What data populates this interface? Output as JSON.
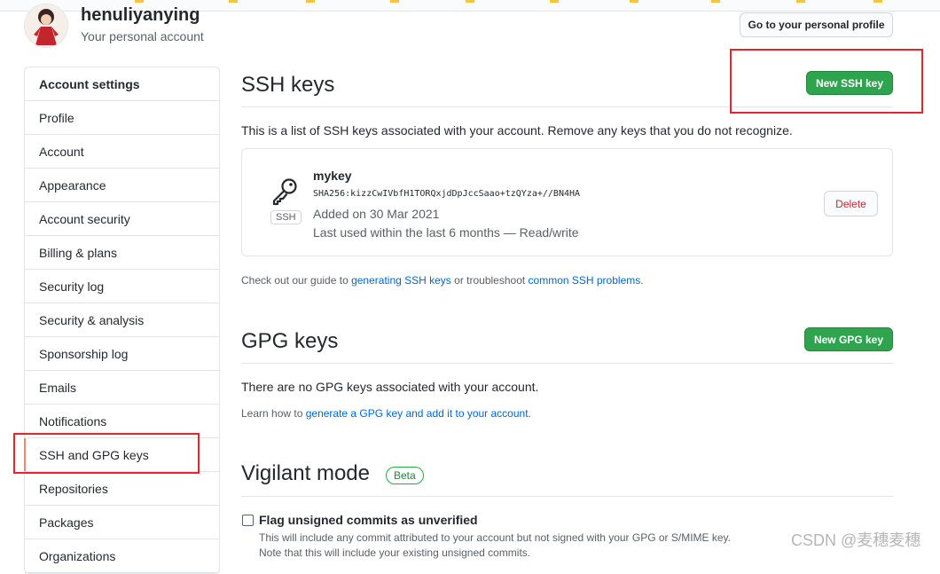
{
  "user": {
    "name": "henuliyanying",
    "subtitle": "Your personal account",
    "profile_button": "Go to your personal profile"
  },
  "sidebar": {
    "items": [
      {
        "label": "Account settings"
      },
      {
        "label": "Profile"
      },
      {
        "label": "Account"
      },
      {
        "label": "Appearance"
      },
      {
        "label": "Account security"
      },
      {
        "label": "Billing & plans"
      },
      {
        "label": "Security log"
      },
      {
        "label": "Security & analysis"
      },
      {
        "label": "Sponsorship log"
      },
      {
        "label": "Emails"
      },
      {
        "label": "Notifications"
      },
      {
        "label": "SSH and GPG keys"
      },
      {
        "label": "Repositories"
      },
      {
        "label": "Packages"
      },
      {
        "label": "Organizations"
      }
    ]
  },
  "ssh": {
    "title": "SSH keys",
    "new_button": "New SSH key",
    "description": "This is a list of SSH keys associated with your account. Remove any keys that you do not recognize.",
    "key": {
      "name": "mykey",
      "fingerprint": "SHA256:kizzCwIVbfH1TORQxjdDpJccSaao+tzQYza+//BN4HA",
      "added": "Added on 30 Mar 2021",
      "last_used": "Last used within the last 6 months — Read/write",
      "type_label": "SSH",
      "delete_button": "Delete"
    },
    "guide_prefix": "Check out our guide to ",
    "guide_link1": "generating SSH keys",
    "guide_middle": " or troubleshoot ",
    "guide_link2": "common SSH problems",
    "guide_suffix": "."
  },
  "gpg": {
    "title": "GPG keys",
    "new_button": "New GPG key",
    "empty_text": "There are no GPG keys associated with your account.",
    "learn_prefix": "Learn how to ",
    "learn_link": "generate a GPG key and add it to your account",
    "learn_suffix": "."
  },
  "vigilant": {
    "title": "Vigilant mode",
    "badge": "Beta",
    "checkbox_label": "Flag unsigned commits as unverified",
    "desc1": "This will include any commit attributed to your account but not signed with your GPG or S/MIME key.",
    "desc2": "Note that this will include your existing unsigned commits."
  },
  "watermark": "CSDN @麦穗麦穗",
  "colors": {
    "accent_green": "#2ea44f",
    "link_blue": "#0366d6",
    "annotation_red": "#e8232b",
    "selected_marker": "#f9826c"
  }
}
